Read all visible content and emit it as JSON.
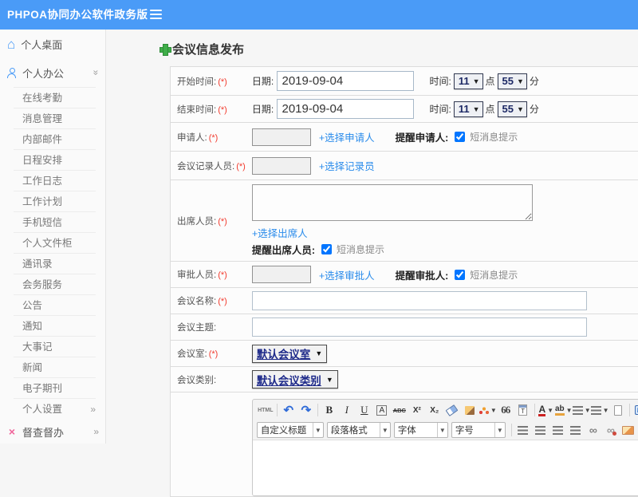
{
  "header": {
    "title": "PHPOA协同办公软件政务版",
    "bg_color": "#4a9bf7"
  },
  "sidebar": {
    "desktop": "个人桌面",
    "office": "个人办公",
    "items": [
      "在线考勤",
      "消息管理",
      "内部邮件",
      "日程安排",
      "工作日志",
      "工作计划",
      "手机短信",
      "个人文件柜",
      "通讯录",
      "会务服务",
      "公告",
      "通知",
      "大事记",
      "新闻",
      "电子期刊",
      "个人设置"
    ],
    "inspect": "督查督办"
  },
  "page": {
    "title": "会议信息发布",
    "accent_green": "#3fae49",
    "link_color": "#2b8ceb",
    "required_color": "#f23b2e"
  },
  "form": {
    "start": {
      "label": "开始时间:",
      "req": "(*)",
      "date_label": "日期:",
      "date": "2019-09-04",
      "time_label": "时间:",
      "hour": "11",
      "hour_unit": "点",
      "minute": "55",
      "minute_unit": "分"
    },
    "end": {
      "label": "结束时间:",
      "req": "(*)",
      "date_label": "日期:",
      "date": "2019-09-04",
      "time_label": "时间:",
      "hour": "11",
      "hour_unit": "点",
      "minute": "55",
      "minute_unit": "分"
    },
    "applicant": {
      "label": "申请人:",
      "req": "(*)",
      "value": "",
      "link": "+选择申请人",
      "remind": "提醒申请人:",
      "sms": "短消息提示",
      "sms_checked": "checked"
    },
    "recorder": {
      "label": "会议记录人员:",
      "req": "(*)",
      "value": "",
      "link": "+选择记录员"
    },
    "attendee": {
      "label": "出席人员:",
      "req": "(*)",
      "value": "",
      "link": "+选择出席人",
      "remind": "提醒出席人员:",
      "sms": "短消息提示",
      "sms_checked": "checked"
    },
    "approver": {
      "label": "审批人员:",
      "req": "(*)",
      "value": "",
      "link": "+选择审批人",
      "remind": "提醒审批人:",
      "sms": "短消息提示",
      "sms_checked": "checked"
    },
    "name": {
      "label": "会议名称:",
      "req": "(*)",
      "value": ""
    },
    "subject": {
      "label": "会议主题:",
      "value": ""
    },
    "room": {
      "label": "会议室:",
      "req": "(*)",
      "value": "默认会议室"
    },
    "category": {
      "label": "会议类别:",
      "value": "默认会议类别"
    }
  },
  "editor": {
    "html_label": "HTML",
    "bold": "B",
    "italic": "I",
    "underline": "U",
    "char_border": "A",
    "strike": "ABC",
    "superscript": "X²",
    "subscript": "X₂",
    "quote": "66",
    "font_color": "A",
    "highlight": "ab",
    "selects": {
      "heading": "自定义标题",
      "paragraph": "段落格式",
      "font": "字体",
      "size": "字号"
    }
  }
}
